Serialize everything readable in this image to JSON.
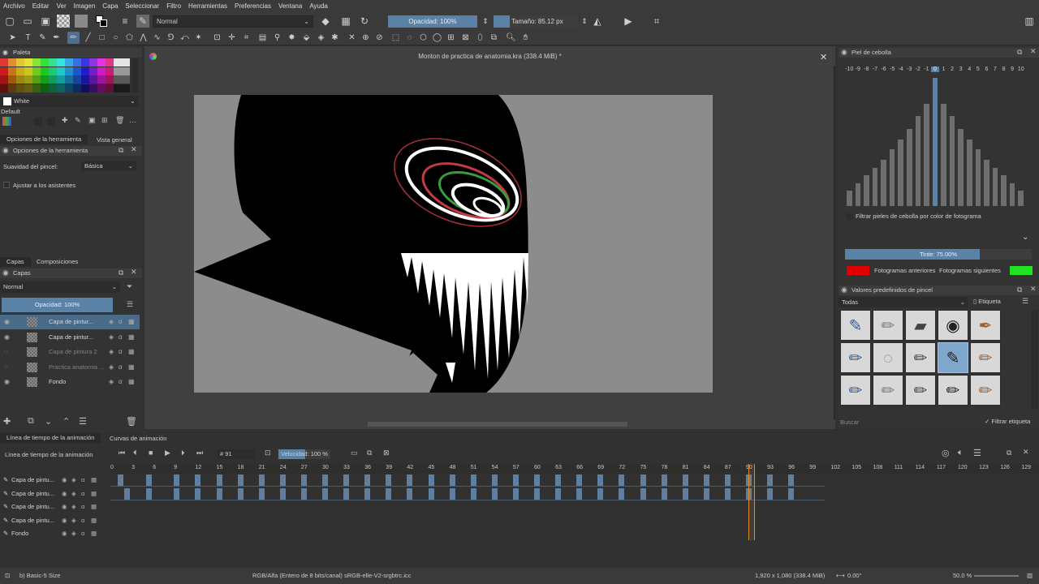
{
  "menu": [
    "Archivo",
    "Editar",
    "Ver",
    "Imagen",
    "Capa",
    "Seleccionar",
    "Filtro",
    "Herramientas",
    "Preferencias",
    "Ventana",
    "Ayuda"
  ],
  "toolbar": {
    "blend_mode": "Normal",
    "opacity_label": "Opacidad: 100%",
    "size_label": "Tamaño: 85.12 px"
  },
  "palette": {
    "title": "Paleta",
    "current_color": "White",
    "palette_name": "Default"
  },
  "tool_options": {
    "tabs": [
      "Opciones de la herramienta",
      "Vista general"
    ],
    "title": "Opciones de la herramienta",
    "smoothing_label": "Suavidad del pincel:",
    "smoothing_value": "Básica",
    "assistants_label": "Ajustar a los asistentes"
  },
  "layers": {
    "tabs": [
      "Capas",
      "Composiciones"
    ],
    "title": "Capas",
    "blend_mode": "Normal",
    "opacity_label": "Opacidad:  100%",
    "items": [
      {
        "name": "Capa de pintur...",
        "selected": true,
        "dim": false
      },
      {
        "name": "Capa de pintur...",
        "selected": false,
        "dim": false
      },
      {
        "name": "Capa de pintura 2",
        "selected": false,
        "dim": true
      },
      {
        "name": "Practica anatomia ...",
        "selected": false,
        "dim": true
      },
      {
        "name": "Fondo",
        "selected": false,
        "dim": false
      }
    ]
  },
  "document": {
    "title": "Monton de practica de anatomia.kra (338.4 MiB) *"
  },
  "onion_skin": {
    "title": "Piel de cebolla",
    "scale": [
      "-10",
      "-9",
      "-8",
      "-7",
      "-6",
      "-5",
      "-4",
      "-3",
      "-2",
      "-1",
      "0",
      "1",
      "2",
      "3",
      "4",
      "5",
      "6",
      "7",
      "8",
      "9",
      "10"
    ],
    "bars": [
      0.12,
      0.18,
      0.24,
      0.3,
      0.36,
      0.44,
      0.52,
      0.6,
      0.7,
      0.8,
      1.0,
      0.8,
      0.7,
      0.6,
      0.52,
      0.44,
      0.36,
      0.3,
      0.24,
      0.18,
      0.12
    ],
    "filter_label": "Filtrar pieles de cebolla por color de fotograma",
    "tint_label": "Tinte: 75.00%",
    "prev_label": "Fotogramas anteriores",
    "next_label": "Fotogramas siguientes",
    "prev_color": "#e00000",
    "next_color": "#22e022"
  },
  "brush_presets": {
    "title": "Valores predefinidos de pincel",
    "filter": "Todas",
    "tag_label": "Etiqueta",
    "search_placeholder": "Buscar",
    "filter_tag_label": "Filtrar etiqueta"
  },
  "timeline": {
    "tabs": [
      "Línea de tiempo de la animación",
      "Curvas de animación"
    ],
    "title": "Línea de tiempo de la animación",
    "frame_value": "91",
    "speed_label": "Velocidad: 100 %",
    "ruler": [
      "0",
      "3",
      "6",
      "9",
      "12",
      "15",
      "18",
      "21",
      "24",
      "27",
      "30",
      "33",
      "36",
      "39",
      "42",
      "45",
      "48",
      "51",
      "54",
      "57",
      "60",
      "63",
      "66",
      "69",
      "72",
      "75",
      "78",
      "81",
      "84",
      "87",
      "90",
      "93",
      "96",
      "99",
      "102",
      "105",
      "108",
      "111",
      "114",
      "117",
      "120",
      "123",
      "126",
      "129"
    ],
    "layers": [
      "Capa de pintu...",
      "Capa de pintu...",
      "Capa de pintu...",
      "Capa de pintu...",
      "Fondo"
    ]
  },
  "status": {
    "brush": "b) Basic-5 Size",
    "color_model": "RGB/Alfa (Entero de 8 bits/canal)  sRGB-elle-V2-srgbtrc.icc",
    "dimensions": "1,920 x 1,080 (338.4 MiB)",
    "rotation": "0.00°",
    "zoom": "50.0 %"
  },
  "colors": {
    "accent": "#5a81a6",
    "selection": "#4a6a8a",
    "playhead": "#e08a2a"
  }
}
